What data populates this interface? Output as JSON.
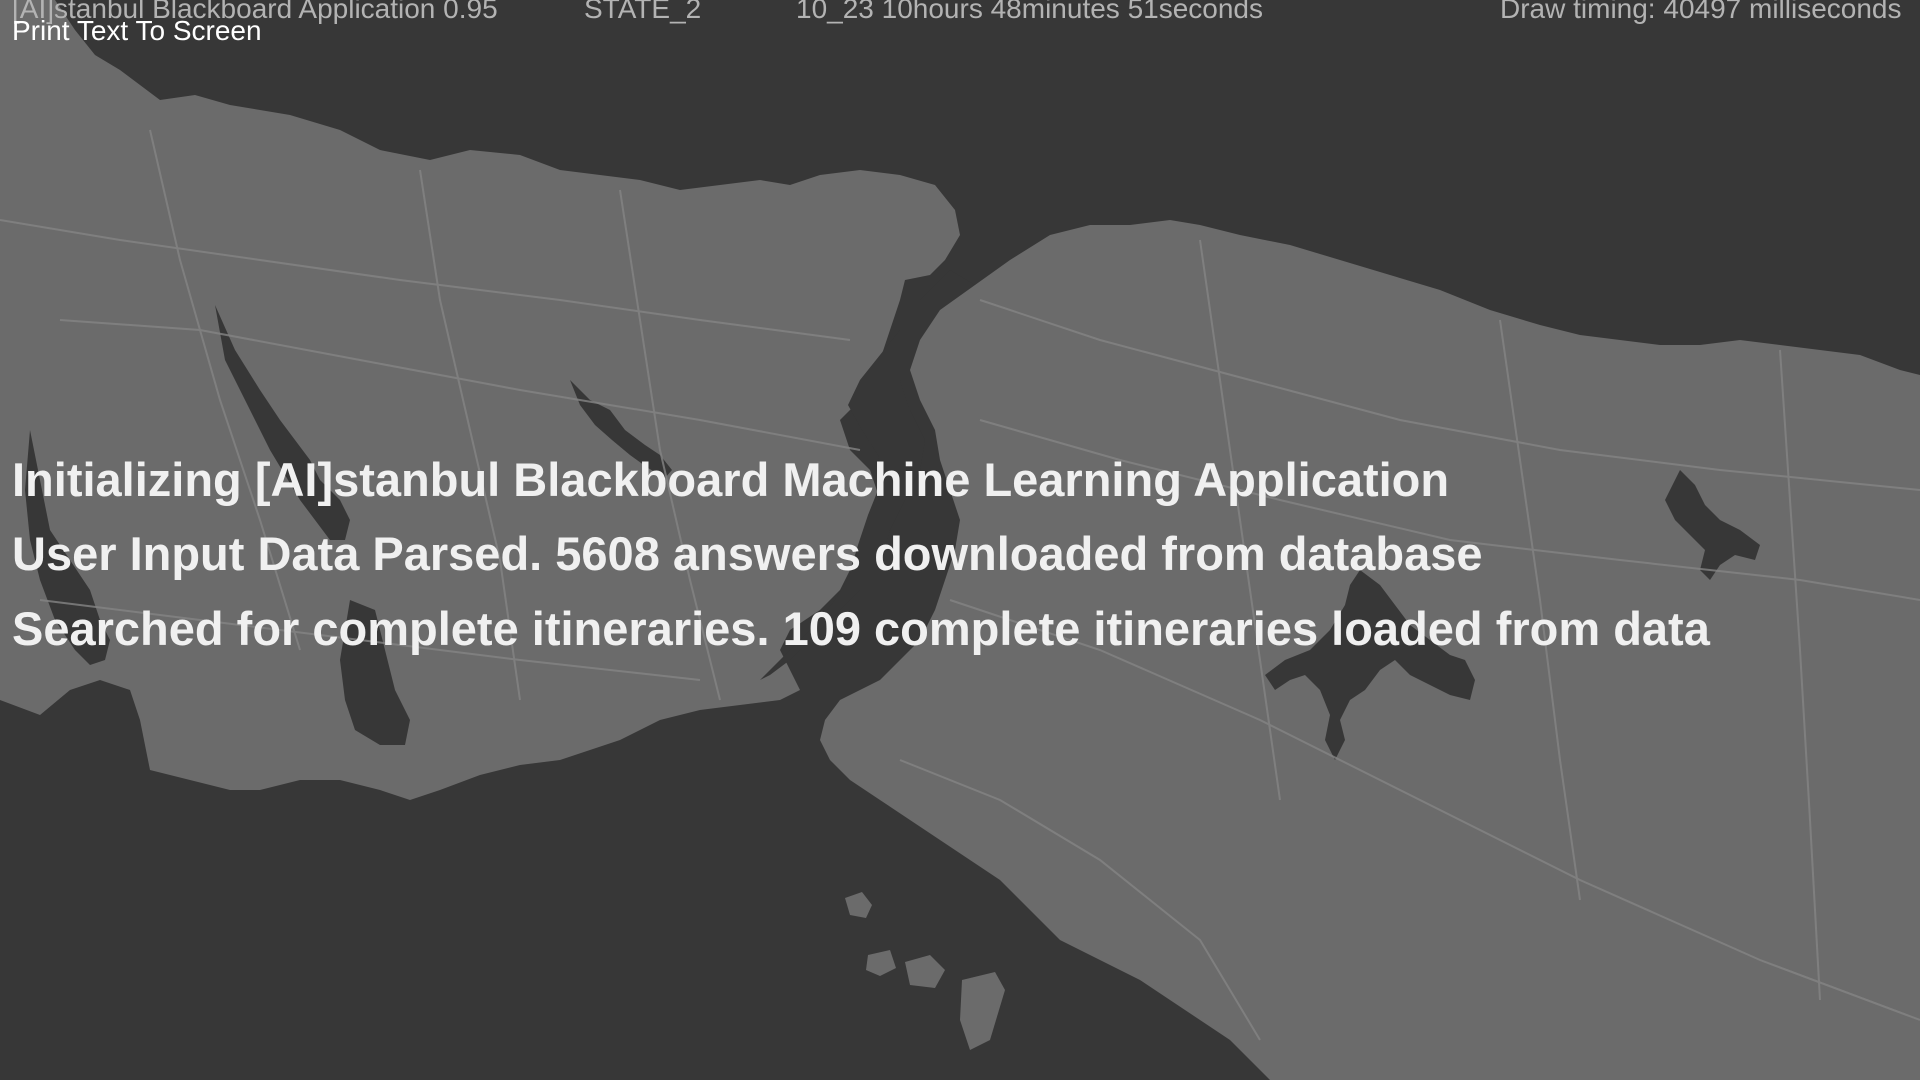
{
  "header": {
    "app_title": "[AI]stanbul Blackboard Application 0.95",
    "state": "STATE_2",
    "elapsed": "10_23  10hours 48minutes 51seconds",
    "draw_timing": "Draw timing: 40497 milliseconds"
  },
  "debug_label": "Print Text To Screen",
  "messages": [
    "Initializing [AI]stanbul Blackboard Machine Learning Application",
    "User Input Data Parsed. 5608 answers downloaded from database",
    "Searched for complete itineraries. 109 complete itineraries loaded from data"
  ],
  "colors": {
    "water": "#373737",
    "land": "#6b6b6b",
    "roads": "#858585",
    "hud_text": "#b3b3b3",
    "message_text": "#f0f0f0"
  }
}
